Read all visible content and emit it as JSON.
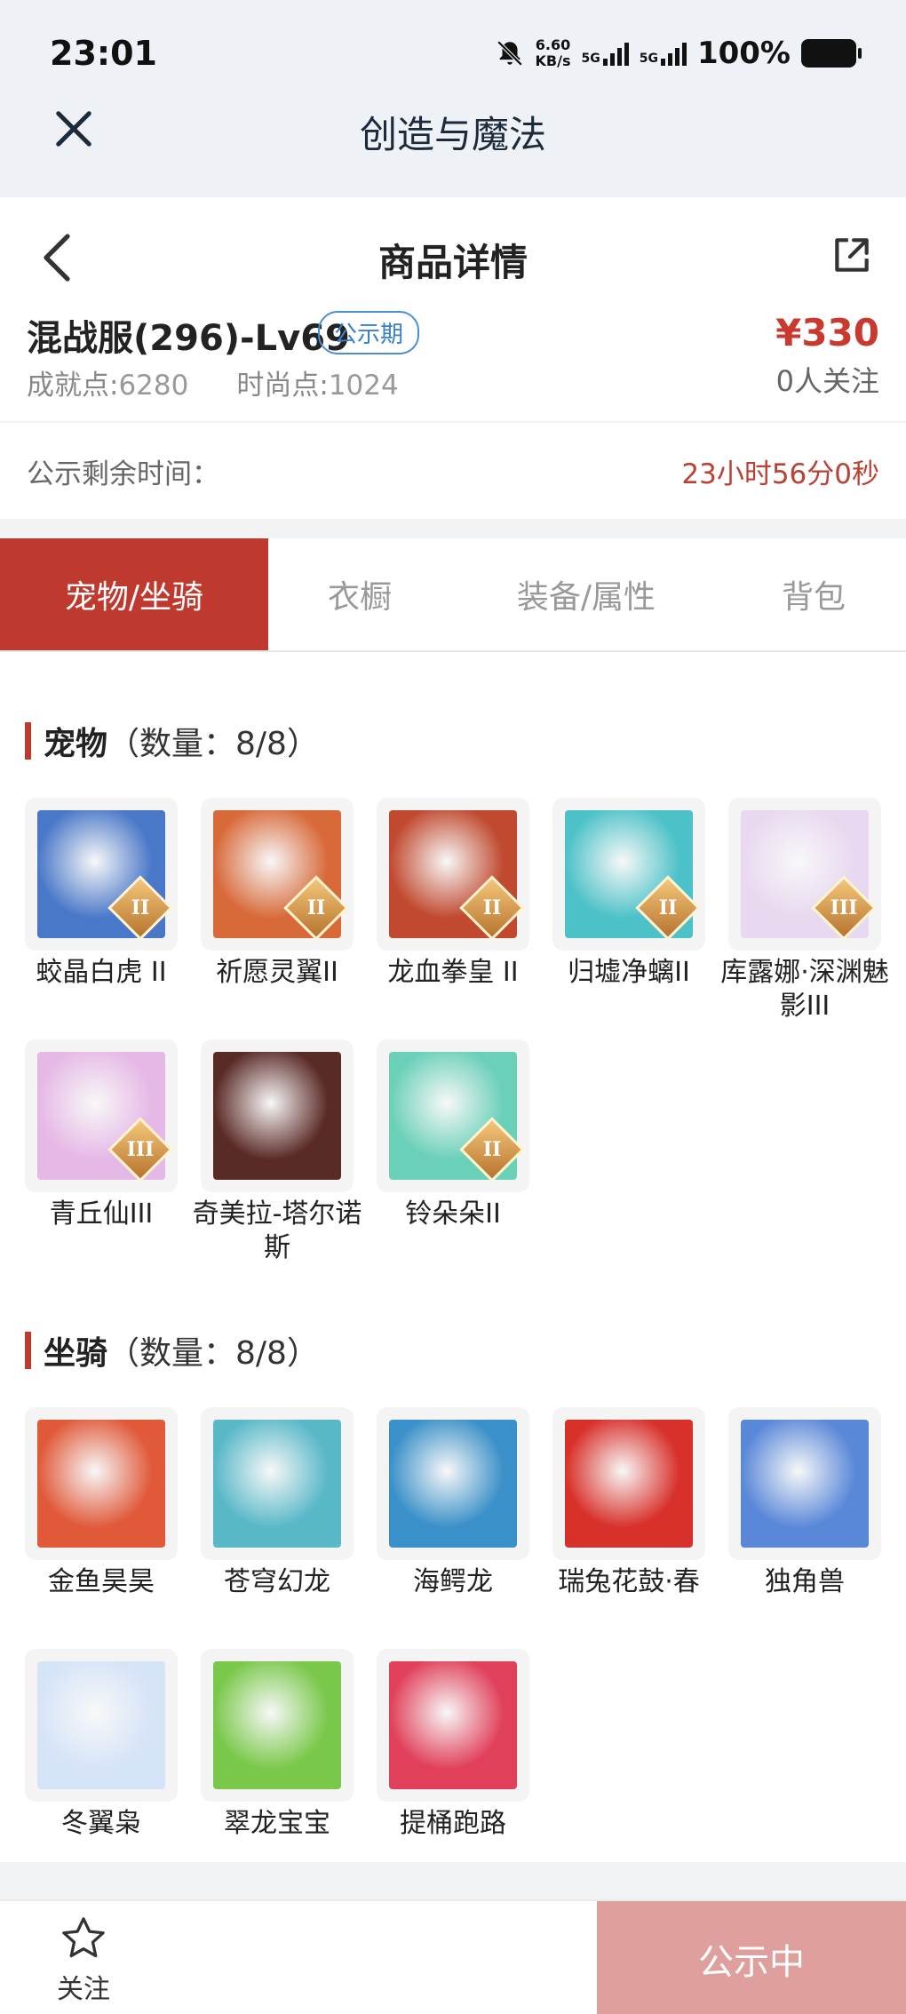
{
  "status_bar": {
    "time": "23:01",
    "net_speed_value": "6.60",
    "net_speed_unit": "KB/s",
    "sim1": "5G",
    "sim2": "5G",
    "battery": "100%"
  },
  "app": {
    "title": "创造与魔法"
  },
  "product": {
    "page_title": "商品详情",
    "server": "混战服(296)-Lv69",
    "badge": "公示期",
    "price": "¥330",
    "followers": "0人关注",
    "achievement_label": "成就点:",
    "achievement_value": "6280",
    "fashion_label": "时尚点:",
    "fashion_value": "1024"
  },
  "timer": {
    "label": "公示剩余时间：",
    "value": "23小时56分0秒"
  },
  "tabs": [
    {
      "label": "宠物/坐骑",
      "active": true
    },
    {
      "label": "衣橱",
      "active": false
    },
    {
      "label": "装备/属性",
      "active": false
    },
    {
      "label": "背包",
      "active": false
    }
  ],
  "pets": {
    "title": "宠物",
    "count": "（数量：8/8）",
    "items": [
      {
        "name": "蛟晶白虎 II",
        "rank": "II",
        "color": "#4a78c8"
      },
      {
        "name": "祈愿灵翼II",
        "rank": "II",
        "color": "#d86a3a"
      },
      {
        "name": "龙血拳皇 II",
        "rank": "II",
        "color": "#c0492f"
      },
      {
        "name": "归墟净螭II",
        "rank": "II",
        "color": "#4cc2c8"
      },
      {
        "name": "库露娜·深渊魅影III",
        "rank": "III",
        "color": "#e8d8f0"
      },
      {
        "name": "青丘仙III",
        "rank": "III",
        "color": "#e6b8e6"
      },
      {
        "name": "奇美拉-塔尔诺斯",
        "rank": "",
        "color": "#5a2a26"
      },
      {
        "name": "铃朵朵II",
        "rank": "II",
        "color": "#6ad0b8"
      }
    ]
  },
  "mounts": {
    "title": "坐骑",
    "count": "（数量：8/8）",
    "items": [
      {
        "name": "金鱼昊昊",
        "color": "#e05a3a"
      },
      {
        "name": "苍穹幻龙",
        "color": "#58b8c8"
      },
      {
        "name": "海鳄龙",
        "color": "#3a90c8"
      },
      {
        "name": "瑞兔花鼓·春",
        "color": "#d8302a"
      },
      {
        "name": "独角兽",
        "color": "#5a88d8"
      },
      {
        "name": "冬翼枭",
        "color": "#d6e4f8"
      },
      {
        "name": "翠龙宝宝",
        "color": "#7ac84a"
      },
      {
        "name": "提桶跑路",
        "color": "#e0405a"
      }
    ]
  },
  "bottom": {
    "follow_label": "关注",
    "cta_label": "公示中"
  }
}
